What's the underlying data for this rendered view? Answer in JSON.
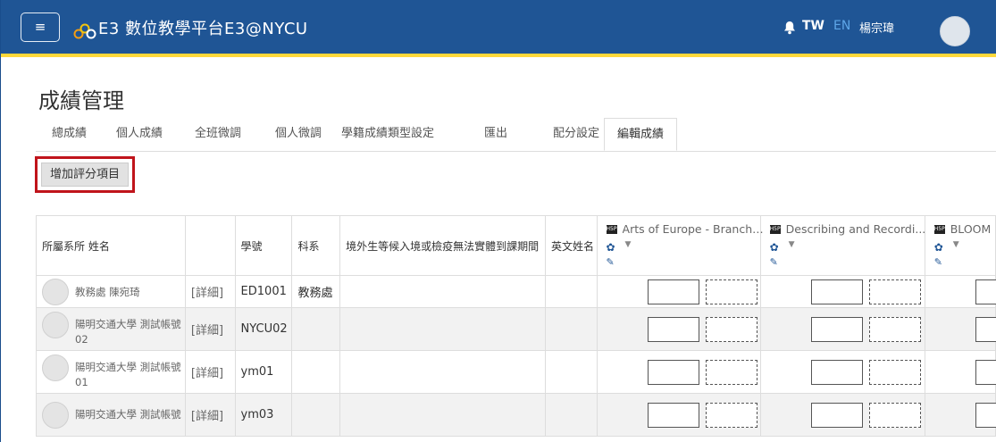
{
  "navbar": {
    "menu_label": "≡",
    "brand": "E3 數位教學平台E3@NYCU",
    "lang_tw": "TW",
    "lang_en": "EN",
    "user_name": "楊宗瑋"
  },
  "page": {
    "title": "成績管理"
  },
  "tabs": [
    {
      "label": "總成績"
    },
    {
      "label": "個人成績"
    },
    {
      "label": "全班微調"
    },
    {
      "label": "個人微調"
    },
    {
      "label": "學籍成績類型設定"
    },
    {
      "label": "匯出"
    },
    {
      "label": "配分設定"
    },
    {
      "label": "編輯成績",
      "active": true
    }
  ],
  "actions": {
    "add_item": "增加評分項目"
  },
  "table": {
    "headers": {
      "name": "所屬系所 姓名",
      "id": "學號",
      "dept": "科系",
      "overseas": "境外生等候入境或檢疫無法實體到課期間",
      "eng_name": "英文姓名"
    },
    "items": [
      {
        "name": "Arts of Europe - Branchi..."
      },
      {
        "name": "Describing and Recordi..."
      },
      {
        "name": "BLOOM"
      }
    ],
    "rows": [
      {
        "name": "教務處 陳宛琦",
        "detail": "[詳細]",
        "id": "ED1001",
        "dept": "教務處"
      },
      {
        "name": "陽明交通大學 測試帳號 02",
        "detail": "[詳細]",
        "id": "NYCU02",
        "dept": ""
      },
      {
        "name": "陽明交通大學 測試帳號 01",
        "detail": "[詳細]",
        "id": "ym01",
        "dept": ""
      },
      {
        "name": "陽明交通大學 測試帳號",
        "detail": "[詳細]",
        "id": "ym03",
        "dept": ""
      }
    ]
  },
  "colors": {
    "navbar": "#1f5595",
    "accent_line": "#ffd83a",
    "highlight_border": "#c0141b"
  }
}
